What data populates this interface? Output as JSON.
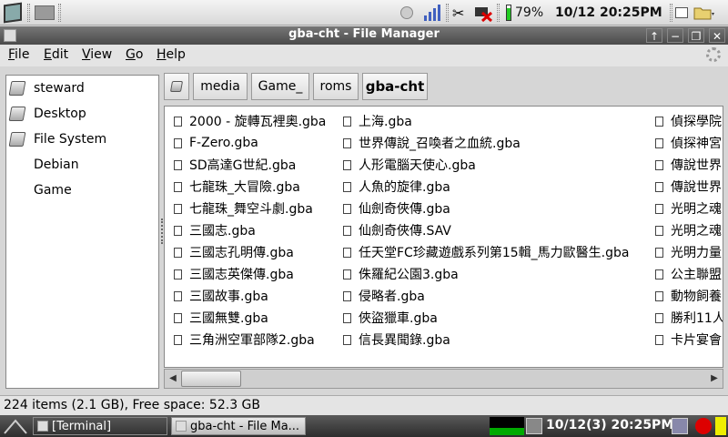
{
  "top_panel": {
    "battery": "79%",
    "datetime": "10/12 20:25PM"
  },
  "window": {
    "title": "gba-cht - File Manager",
    "buttons": {
      "up": "↑",
      "minimize": "−",
      "restore": "❐",
      "close": "✕"
    }
  },
  "menu": {
    "file": "File",
    "edit": "Edit",
    "view": "View",
    "go": "Go",
    "help": "Help"
  },
  "sidebar": {
    "items": [
      {
        "label": "steward",
        "icon": "home-drive-icon"
      },
      {
        "label": "Desktop",
        "icon": "desktop-drive-icon"
      },
      {
        "label": "File System",
        "icon": "filesystem-drive-icon"
      },
      {
        "label": "Debian",
        "icon": ""
      },
      {
        "label": "Game",
        "icon": ""
      }
    ]
  },
  "path": {
    "crumbs": [
      "media",
      "Game_",
      "roms",
      "gba-cht"
    ],
    "active_index": 3
  },
  "files": {
    "col1": [
      "2000 - 旋轉瓦裡奧.gba",
      "F-Zero.gba",
      "SD高達G世紀.gba",
      "七龍珠_大冒險.gba",
      "七龍珠_舞空斗劇.gba",
      "三國志.gba",
      "三國志孔明傳.gba",
      "三國志英傑傳.gba",
      "三國故事.gba",
      "三國無雙.gba",
      "三角洲空軍部隊2.gba"
    ],
    "col2": [
      "上海.gba",
      "世界傳說_召喚者之血統.gba",
      "人形電腦天使心.gba",
      "人魚的旋律.gba",
      "仙劍奇俠傳.gba",
      "仙劍奇俠傳.SAV",
      "任天堂FC珍藏遊戲系列第15輯_馬力歐醫生.gba",
      "侏羅紀公園3.gba",
      "侵略者.gba",
      "俠盜獵車.gba",
      "信長異聞錄.gba"
    ],
    "col3": [
      "偵探學院",
      "偵探神宮",
      "傳說世界",
      "傳說世界",
      "光明之魂",
      "光明之魂",
      "光明力量",
      "公主聯盟",
      "動物飼養",
      "勝利11人",
      "卡片宴會"
    ]
  },
  "status": {
    "text": "224 items (2.1 GB), Free space: 52.3 GB"
  },
  "taskbar": {
    "tasks": [
      "[Terminal]",
      "gba-cht - File Ma..."
    ],
    "clock": "10/12(3) 20:25PM"
  }
}
